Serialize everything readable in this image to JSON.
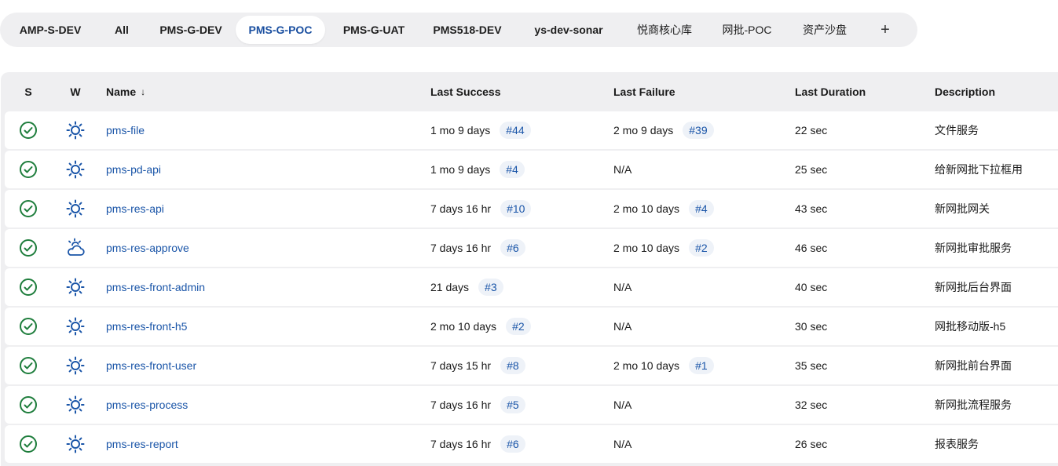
{
  "tabs": [
    {
      "label": "AMP-S-DEV",
      "active": false
    },
    {
      "label": "All",
      "active": false
    },
    {
      "label": "PMS-G-DEV",
      "active": false
    },
    {
      "label": "PMS-G-POC",
      "active": true
    },
    {
      "label": "PMS-G-UAT",
      "active": false
    },
    {
      "label": "PMS518-DEV",
      "active": false
    },
    {
      "label": "ys-dev-sonar",
      "active": false
    },
    {
      "label": "悦商核心库",
      "active": false
    },
    {
      "label": "网批-POC",
      "active": false
    },
    {
      "label": "资产沙盘",
      "active": false
    }
  ],
  "add_tab_label": "+",
  "table": {
    "headers": {
      "s": "S",
      "w": "W",
      "name": "Name",
      "name_sort": "↓",
      "last_success": "Last Success",
      "last_failure": "Last Failure",
      "last_duration": "Last Duration",
      "description": "Description"
    },
    "rows": [
      {
        "name": "pms-file",
        "status": "success",
        "weather": "sunny",
        "last_success": "1 mo 9 days",
        "success_build": "#44",
        "last_failure": "2 mo 9 days",
        "failure_build": "#39",
        "duration": "22 sec",
        "description": "文件服务"
      },
      {
        "name": "pms-pd-api",
        "status": "success",
        "weather": "sunny",
        "last_success": "1 mo 9 days",
        "success_build": "#4",
        "last_failure": "N/A",
        "failure_build": "",
        "duration": "25 sec",
        "description": "给新网批下拉框用"
      },
      {
        "name": "pms-res-api",
        "status": "success",
        "weather": "sunny",
        "last_success": "7 days 16 hr",
        "success_build": "#10",
        "last_failure": "2 mo 10 days",
        "failure_build": "#4",
        "duration": "43 sec",
        "description": "新网批网关"
      },
      {
        "name": "pms-res-approve",
        "status": "success",
        "weather": "partly-cloudy",
        "last_success": "7 days 16 hr",
        "success_build": "#6",
        "last_failure": "2 mo 10 days",
        "failure_build": "#2",
        "duration": "46 sec",
        "description": "新网批审批服务"
      },
      {
        "name": "pms-res-front-admin",
        "status": "success",
        "weather": "sunny",
        "last_success": "21 days",
        "success_build": "#3",
        "last_failure": "N/A",
        "failure_build": "",
        "duration": "40 sec",
        "description": "新网批后台界面"
      },
      {
        "name": "pms-res-front-h5",
        "status": "success",
        "weather": "sunny",
        "last_success": "2 mo 10 days",
        "success_build": "#2",
        "last_failure": "N/A",
        "failure_build": "",
        "duration": "30 sec",
        "description": "网批移动版-h5"
      },
      {
        "name": "pms-res-front-user",
        "status": "success",
        "weather": "sunny",
        "last_success": "7 days 15 hr",
        "success_build": "#8",
        "last_failure": "2 mo 10 days",
        "failure_build": "#1",
        "duration": "35 sec",
        "description": "新网批前台界面"
      },
      {
        "name": "pms-res-process",
        "status": "success",
        "weather": "sunny",
        "last_success": "7 days 16 hr",
        "success_build": "#5",
        "last_failure": "N/A",
        "failure_build": "",
        "duration": "32 sec",
        "description": "新网批流程服务"
      },
      {
        "name": "pms-res-report",
        "status": "success",
        "weather": "sunny",
        "last_success": "7 days 16 hr",
        "success_build": "#6",
        "last_failure": "N/A",
        "failure_build": "",
        "duration": "26 sec",
        "description": "报表服务"
      }
    ]
  },
  "colors": {
    "accent": "#1a55a8",
    "success": "#1e7d3c",
    "weather": "#1a55a8",
    "panel_bg": "#efeff1"
  }
}
